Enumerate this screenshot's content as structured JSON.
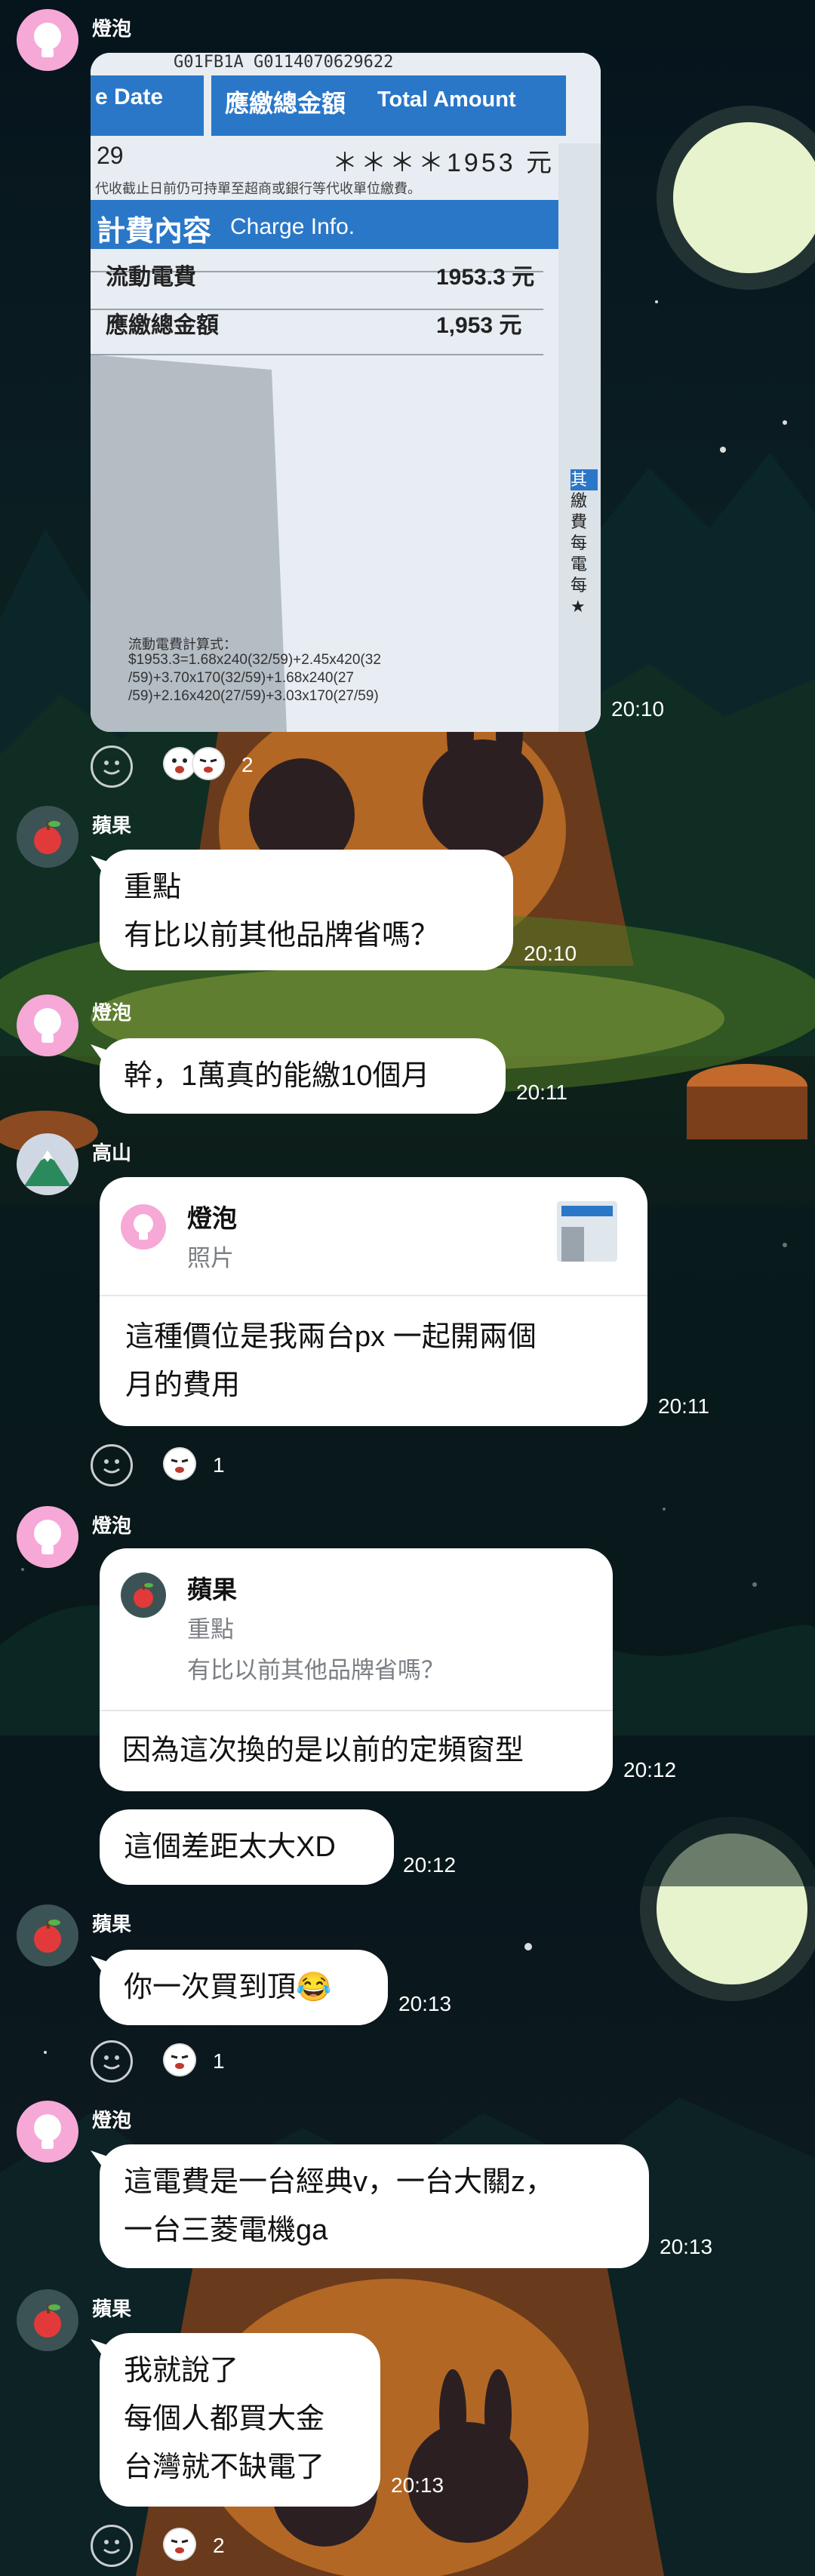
{
  "colors": {
    "bubble": "#ffffff",
    "text": "#111111",
    "sub": "#7b7f84",
    "time": "#ffffff",
    "moon": "#e8f3cc",
    "bill_blue": "#2a77c8"
  },
  "messages": [
    {
      "id": "m1",
      "sender": "燈泡",
      "avatar": "lightbulb-avatar",
      "type": "photo",
      "photo": {
        "barcode": "G01FB1A G0114070629622",
        "due_label": "e Date",
        "due_value": "29",
        "total_zh": "應繳總金額",
        "total_en": "Total Amount",
        "total_value": "＊＊＊＊1953 元",
        "notice": "代收截止日前仍可持單至超商或銀行等代收單位繳費。",
        "charge_zh": "計費內容",
        "charge_en": "Charge Info.",
        "rows": [
          {
            "label": "流動電費",
            "value": "1953.3 元"
          },
          {
            "label": "應繳總金額",
            "value": "1,953 元"
          }
        ],
        "formula_title": "流動電費計算式：",
        "formula_lines": [
          "$1953.3=1.68x240(32/59)+2.45x420(32",
          "/59)+3.70x170(32/59)+1.68x240(27",
          "/59)+2.16x420(27/59)+3.03x170(27/59)"
        ],
        "side_chars": [
          "其",
          "繳",
          "費",
          "每",
          "電",
          "每",
          "★"
        ]
      },
      "time": "20:10",
      "reaction_count": "2"
    },
    {
      "id": "m2",
      "sender": "蘋果",
      "avatar": "apple-avatar",
      "type": "text",
      "lines": [
        "重點",
        "有比以前其他品牌省嗎？"
      ],
      "time": "20:10"
    },
    {
      "id": "m3",
      "sender": "燈泡",
      "avatar": "lightbulb-avatar",
      "type": "text",
      "lines": [
        "幹，1萬真的能繳10個月"
      ],
      "time": "20:11"
    },
    {
      "id": "m4",
      "sender": "高山",
      "avatar": "mountain-avatar",
      "type": "reply",
      "quote": {
        "sender": "燈泡",
        "text": "照片"
      },
      "lines": [
        "這種價位是我兩台px 一起開兩個",
        "月的費用"
      ],
      "time": "20:11",
      "reaction_count": "1"
    },
    {
      "id": "m5",
      "sender": "燈泡",
      "avatar": "lightbulb-avatar",
      "type": "reply",
      "quote": {
        "sender": "蘋果",
        "line1": "重點",
        "line2": "有比以前其他品牌省嗎？"
      },
      "lines": [
        "因為這次換的是以前的定頻窗型"
      ],
      "time": "20:12"
    },
    {
      "id": "m6",
      "sender": "",
      "type": "text",
      "lines": [
        "這個差距太大XD"
      ],
      "time": "20:12"
    },
    {
      "id": "m7",
      "sender": "蘋果",
      "avatar": "apple-avatar",
      "type": "text",
      "lines": [
        "你一次買到頂😂"
      ],
      "time": "20:13",
      "reaction_count": "1"
    },
    {
      "id": "m8",
      "sender": "燈泡",
      "avatar": "lightbulb-avatar",
      "type": "text",
      "lines": [
        "這電費是一台經典v，一台大關z，",
        "一台三菱電機ga"
      ],
      "time": "20:13"
    },
    {
      "id": "m9",
      "sender": "蘋果",
      "avatar": "apple-avatar",
      "type": "text",
      "lines": [
        "我就說了",
        "每個人都買大金",
        "台灣就不缺電了"
      ],
      "time": "20:13",
      "reaction_count": "2"
    }
  ]
}
